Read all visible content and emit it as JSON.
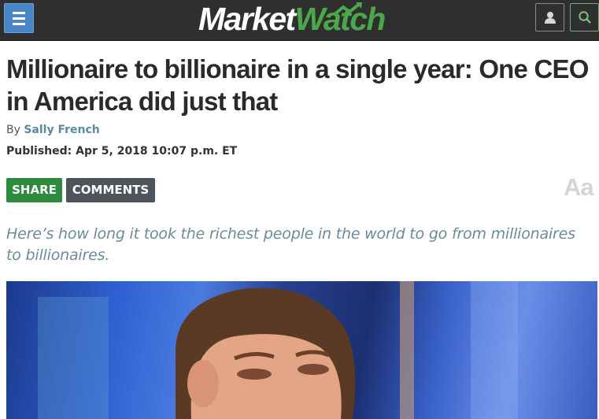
{
  "header": {
    "menu_icon": "hamburger-menu-icon",
    "logo_market": "Market",
    "logo_watch": "Watch",
    "user_icon": "user-icon",
    "search_icon": "search-icon",
    "accent_color": "#4aa84a"
  },
  "article": {
    "headline": "Millionaire to billionaire in a single year: One CEO in America did just that",
    "byline_prefix": "By",
    "author": "Sally French",
    "published": "Published: Apr 5, 2018 10:07 p.m. ET",
    "share_label": "SHARE",
    "comments_label": "COMMENTS",
    "font_size_label": "Aa",
    "dek": "Here’s how long it took the richest people in the world to go from millionaires to billionaires."
  }
}
